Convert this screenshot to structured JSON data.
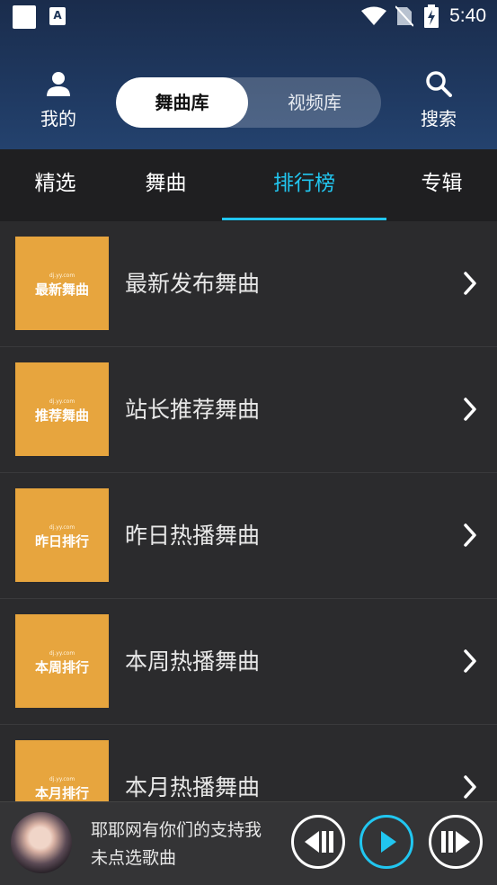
{
  "status_bar": {
    "time": "5:40",
    "app_badge": "A"
  },
  "header": {
    "me_label": "我的",
    "search_label": "搜索",
    "segments": [
      "舞曲库",
      "视频库"
    ]
  },
  "tabs": [
    "精选",
    "舞曲",
    "排行榜",
    "专辑"
  ],
  "active_tab": "排行榜",
  "list": [
    {
      "thumb_text": "最新舞曲",
      "watermark": "dj.yy.com",
      "title": "最新发布舞曲"
    },
    {
      "thumb_text": "推荐舞曲",
      "watermark": "dj.yy.com",
      "title": "站长推荐舞曲"
    },
    {
      "thumb_text": "昨日排行",
      "watermark": "dj.yy.com",
      "title": "昨日热播舞曲"
    },
    {
      "thumb_text": "本周排行",
      "watermark": "dj.yy.com",
      "title": "本周热播舞曲"
    },
    {
      "thumb_text": "本月排行",
      "watermark": "dj.yy.com",
      "title": "本月热播舞曲"
    }
  ],
  "player": {
    "line1": "耶耶网有你们的支持我",
    "line2": "未点选歌曲"
  },
  "colors": {
    "accent": "#21c6f0",
    "thumb": "#e7a53e",
    "header": "#203b64"
  }
}
